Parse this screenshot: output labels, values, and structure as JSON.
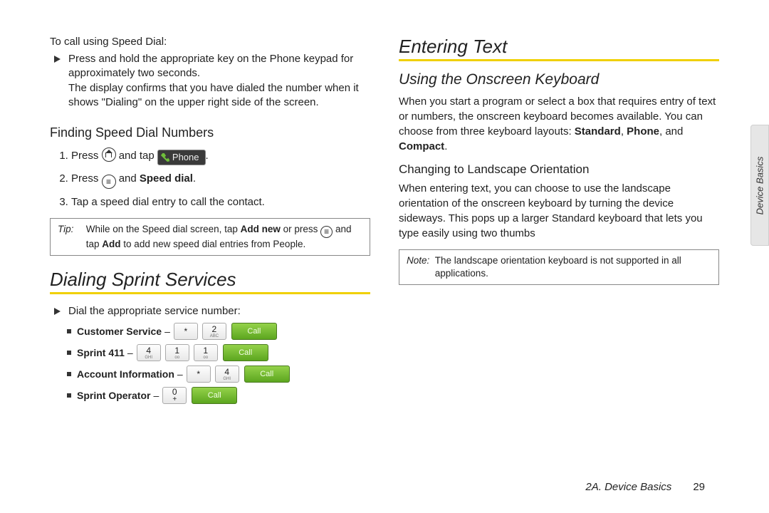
{
  "left": {
    "intro": "To call using Speed Dial:",
    "speedDialBullet": "Press and hold the appropriate key on the Phone keypad for approximately two seconds.",
    "speedDialBullet2": "The display confirms that you have dialed the number when it shows \"Dialing\" on the upper right side of the screen.",
    "findingHeading": "Finding Speed Dial Numbers",
    "step1a": "Press ",
    "step1b": " and tap ",
    "phoneChip": "Phone",
    "step1c": ".",
    "step2a": "Press ",
    "step2b": " and ",
    "step2bold": "Speed dial",
    "step2c": ".",
    "step3": "Tap a speed dial entry to call the contact.",
    "tipLabel": "Tip:",
    "tipBody1": "While on the Speed dial screen, tap ",
    "tipBold1": "Add new",
    "tipBody2": " or press ",
    "tipBody3": " and tap ",
    "tipBold2": "Add",
    "tipBody4": " to add new speed dial entries from People.",
    "dialingHeading": "Dialing Sprint Services",
    "dialIntro": "Dial the appropriate service number:",
    "services": {
      "customer": {
        "name": "Customer Service",
        "keys": [
          "*",
          "2|ABC"
        ]
      },
      "s411": {
        "name": "Sprint 411",
        "keys": [
          "4|GHI",
          "1|oo",
          "1|oo"
        ]
      },
      "account": {
        "name": "Account Information",
        "keys": [
          "*",
          "4|GHI"
        ]
      },
      "operator": {
        "name": "Sprint Operator",
        "keys": [
          "0+"
        ]
      }
    },
    "dash": " – ",
    "callLabel": "Call"
  },
  "right": {
    "enteringHeading": "Entering Text",
    "usingHeading": "Using the Onscreen Keyboard",
    "usingPara1": "When you start a program or select a box that requires entry of text or numbers, the onscreen keyboard becomes available. You can choose from three keyboard layouts: ",
    "kb1": "Standard",
    "sep": ", ",
    "kb2": "Phone",
    "sep2": ", and ",
    "kb3": "Compact",
    "usingPara1end": ".",
    "landscapeHeading": "Changing to Landscape Orientation",
    "landscapePara": "When entering text, you can choose to use the landscape orientation of the onscreen keyboard by turning the device sideways. This pops up a larger Standard keyboard that lets you type easily using two thumbs",
    "noteLabel": "Note:",
    "noteBody": "The landscape orientation keyboard is not supported in all applications."
  },
  "sideTab": "Device Basics",
  "footer": {
    "section": "2A. Device Basics",
    "page": "29"
  }
}
